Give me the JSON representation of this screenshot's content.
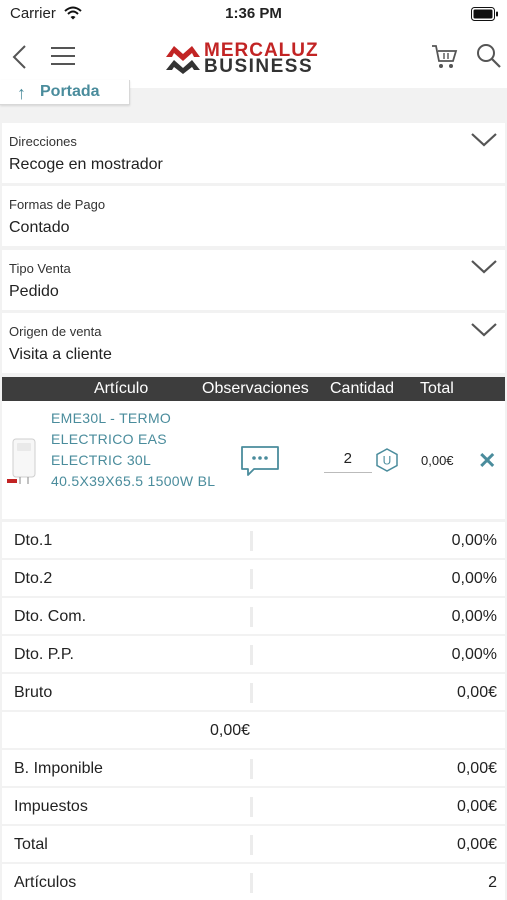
{
  "status_bar": {
    "carrier": "Carrier",
    "time": "1:36 PM"
  },
  "header": {
    "logo_line1": "MERCALUZ",
    "logo_line2": "BUSINESS",
    "accent_color": "#c22424",
    "link_color": "#4a8c9c"
  },
  "breadcrumb": {
    "label": "Portada"
  },
  "fields": [
    {
      "label": "Direcciones",
      "value": "Recoge en mostrador",
      "has_dropdown": true
    },
    {
      "label": "Formas de Pago",
      "value": "Contado",
      "has_dropdown": false
    },
    {
      "label": "Tipo Venta",
      "value": "Pedido",
      "has_dropdown": true
    },
    {
      "label": "Origen de venta",
      "value": "Visita a cliente",
      "has_dropdown": true
    }
  ],
  "table": {
    "headers": [
      "Artículo",
      "Observaciones",
      "Cantidad",
      "Total"
    ],
    "items": [
      {
        "description": "EME30L - TERMO ELECTRICO EAS ELECTRIC 30L 40.5X39X65.5 1500W BL",
        "quantity": "2",
        "unit": "U",
        "total": "0,00€"
      }
    ]
  },
  "totals": [
    {
      "label": "Dto.1",
      "value": "0,00%"
    },
    {
      "label": "Dto.2",
      "value": "0,00%"
    },
    {
      "label": "Dto. Com.",
      "value": "0,00%"
    },
    {
      "label": "Dto. P.P.",
      "value": "0,00%"
    },
    {
      "label": "Bruto",
      "value": "0,00€"
    },
    {
      "label": "",
      "center_value": "0,00€"
    },
    {
      "label": "B. Imponible",
      "value": "0,00€"
    },
    {
      "label": "Impuestos",
      "value": "0,00€"
    },
    {
      "label": "Total",
      "value": "0,00€"
    },
    {
      "label": "Artículos",
      "value": "2"
    }
  ]
}
